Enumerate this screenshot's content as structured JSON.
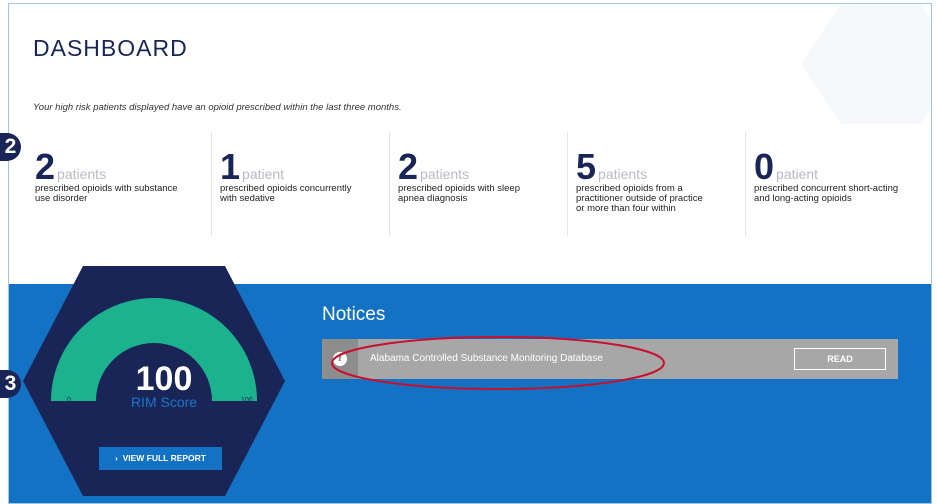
{
  "header": {
    "title": "DASHBOARD",
    "subtitle": "Your high risk patients displayed have an opioid prescribed within the last three months."
  },
  "stats": [
    {
      "value": "2",
      "unit": "patients",
      "description": "prescribed opioids with substance use disorder"
    },
    {
      "value": "1",
      "unit": "patient",
      "description": "prescribed opioids concurrently with sedative"
    },
    {
      "value": "2",
      "unit": "patients",
      "description": "prescribed opioids with sleep apnea diagnosis"
    },
    {
      "value": "5",
      "unit": "patients",
      "description": "prescribed opioids from a practitioner outside of practice or more than four within"
    },
    {
      "value": "0",
      "unit": "patient",
      "description": "prescribed concurrent short-acting and long-acting opioids"
    }
  ],
  "rim": {
    "score": "100",
    "label": "RIM Score",
    "min": "0",
    "max": "100",
    "level": 1.0,
    "button": "VIEW FULL REPORT"
  },
  "notices": {
    "title": "Notices",
    "items": [
      {
        "text": "Alabama Controlled Substance Monitoring Database",
        "action": "READ",
        "icon": "info-icon"
      }
    ]
  },
  "callouts": {
    "badge_a": "2",
    "badge_b": "3"
  },
  "colors": {
    "navy": "#1a2557",
    "blue": "#1372c4",
    "gauge": "#1cb28e",
    "highlight": "#c8102e"
  }
}
